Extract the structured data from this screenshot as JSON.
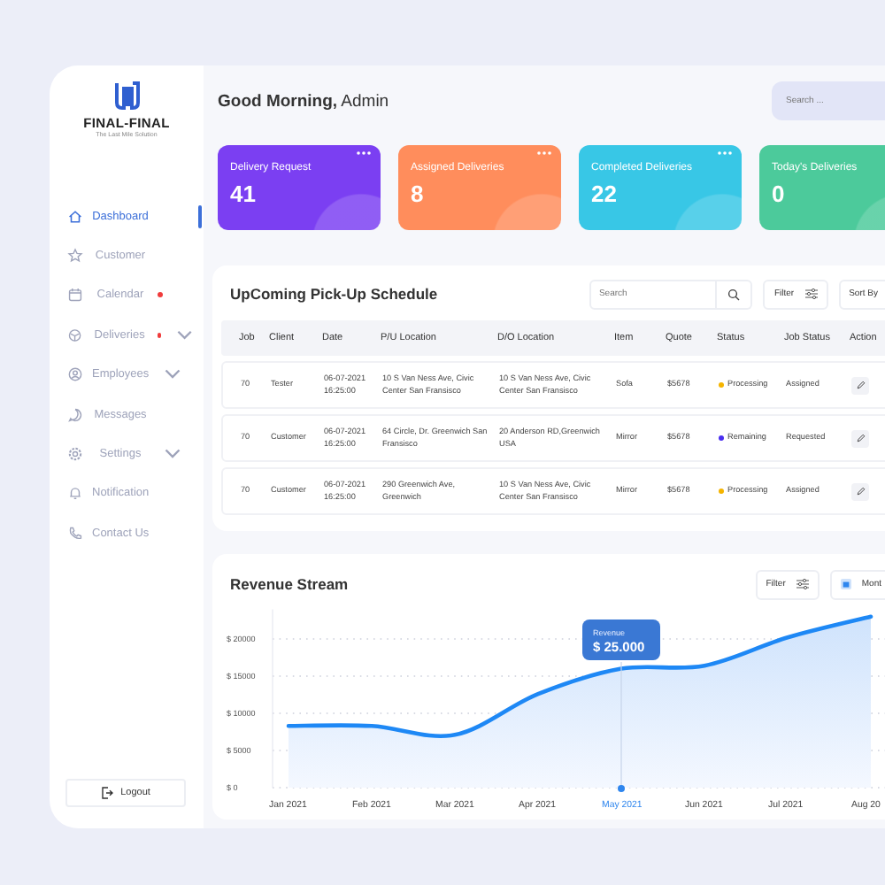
{
  "sidebar": {
    "logo": {
      "name": "FINAL-FINAL",
      "tagline": "The Last Mile Solution"
    },
    "items": [
      {
        "label": "Dashboard",
        "selected": true,
        "dot": false,
        "expandable": false
      },
      {
        "label": "Customer",
        "selected": false,
        "dot": false,
        "expandable": false
      },
      {
        "label": "Calendar",
        "selected": false,
        "dot": true,
        "expandable": false
      },
      {
        "label": "Deliveries",
        "selected": false,
        "dot": true,
        "expandable": true
      },
      {
        "label": "Employees",
        "selected": false,
        "dot": false,
        "expandable": true
      },
      {
        "label": "Messages",
        "selected": false,
        "dot": false,
        "expandable": false
      },
      {
        "label": "Settings",
        "selected": false,
        "dot": false,
        "expandable": true
      },
      {
        "label": "Notification",
        "selected": false,
        "dot": false,
        "expandable": false
      },
      {
        "label": "Contact Us",
        "selected": false,
        "dot": false,
        "expandable": false
      }
    ],
    "logout": "Logout"
  },
  "header": {
    "greeting": "**Good Morning,** Admin",
    "search": {
      "placeholder": "Search ..."
    }
  },
  "cards": [
    {
      "label": "Delivery Request",
      "value": "41",
      "color": "#7b3ff2"
    },
    {
      "label": "Assigned Deliveries",
      "value": "8",
      "color": "#ff8d5c"
    },
    {
      "label": "Completed Deliveries",
      "value": "22",
      "color": "#38c7e6"
    },
    {
      "label": "Today's Deliveries",
      "value": "0",
      "color": "#4cca9b"
    }
  ],
  "schedule": {
    "title": "UpComing Pick-Up Schedule",
    "search": {
      "placeholder": "Search"
    },
    "filter": "Filter",
    "sort": "Sort By",
    "columns": [
      "Job",
      "Client",
      "Date",
      "P/U Location",
      "D/O Location",
      "Item",
      "Quote",
      "Status",
      "Job Status",
      "Action"
    ],
    "rows": [
      {
        "job": "70",
        "client": "Tester",
        "date": "06-07-2021 16:25:00",
        "pickup": "10 S Van Ness Ave, Civic Center San Fransisco",
        "dropoff": "10 S Van Ness Ave, Civic Center San Fransisco",
        "item": "Sofa",
        "quote": "$5678",
        "status": "Processing",
        "color": "#f5b400",
        "job_status": "Assigned"
      },
      {
        "job": "70",
        "client": "Customer",
        "date": "06-07-2021 16:25:00",
        "pickup": "64 Circle, Dr. Greenwich San Fransisco",
        "dropoff": "20 Anderson RD,Greenwich USA",
        "item": "Mirror",
        "quote": "$5678",
        "status": "Remaining",
        "color": "#4a2ff0",
        "job_status": "Requested"
      },
      {
        "job": "70",
        "client": "Customer",
        "date": "06-07-2021 16:25:00",
        "pickup": "290 Greenwich Ave, Greenwich",
        "dropoff": "10 S Van Ness Ave, Civic Center San Fransisco",
        "item": "Mirror",
        "quote": "$5678",
        "status": "Processing",
        "color": "#f5b400",
        "job_status": "Assigned"
      }
    ]
  },
  "revenue": {
    "title": "Revenue Stream",
    "filter": "Filter",
    "period": "Mont",
    "chart_data": {
      "type": "area",
      "grid": true,
      "ylim": [
        0,
        24000
      ],
      "categories": [
        "Jan 2021",
        "Feb 2021",
        "Mar 2021",
        "Apr 2021",
        "May 2021",
        "Jun 2021",
        "Jul 2021",
        "Aug 20"
      ],
      "series": [
        {
          "name": "Revenue",
          "color": "#1e88f5",
          "values": [
            8300,
            8300,
            7100,
            12600,
            16000,
            16400,
            20200,
            23000
          ]
        }
      ],
      "yticks": [
        {
          "value": 0,
          "label": "$ 0"
        },
        {
          "value": 5000,
          "label": "$ 5000"
        },
        {
          "value": 10000,
          "label": "$ 10000"
        },
        {
          "value": 15000,
          "label": "$ 15000"
        },
        {
          "value": 20000,
          "label": "$ 20000"
        }
      ],
      "annotations": [
        {
          "x": "May 2021",
          "text": "$ 25.000"
        }
      ]
    }
  }
}
